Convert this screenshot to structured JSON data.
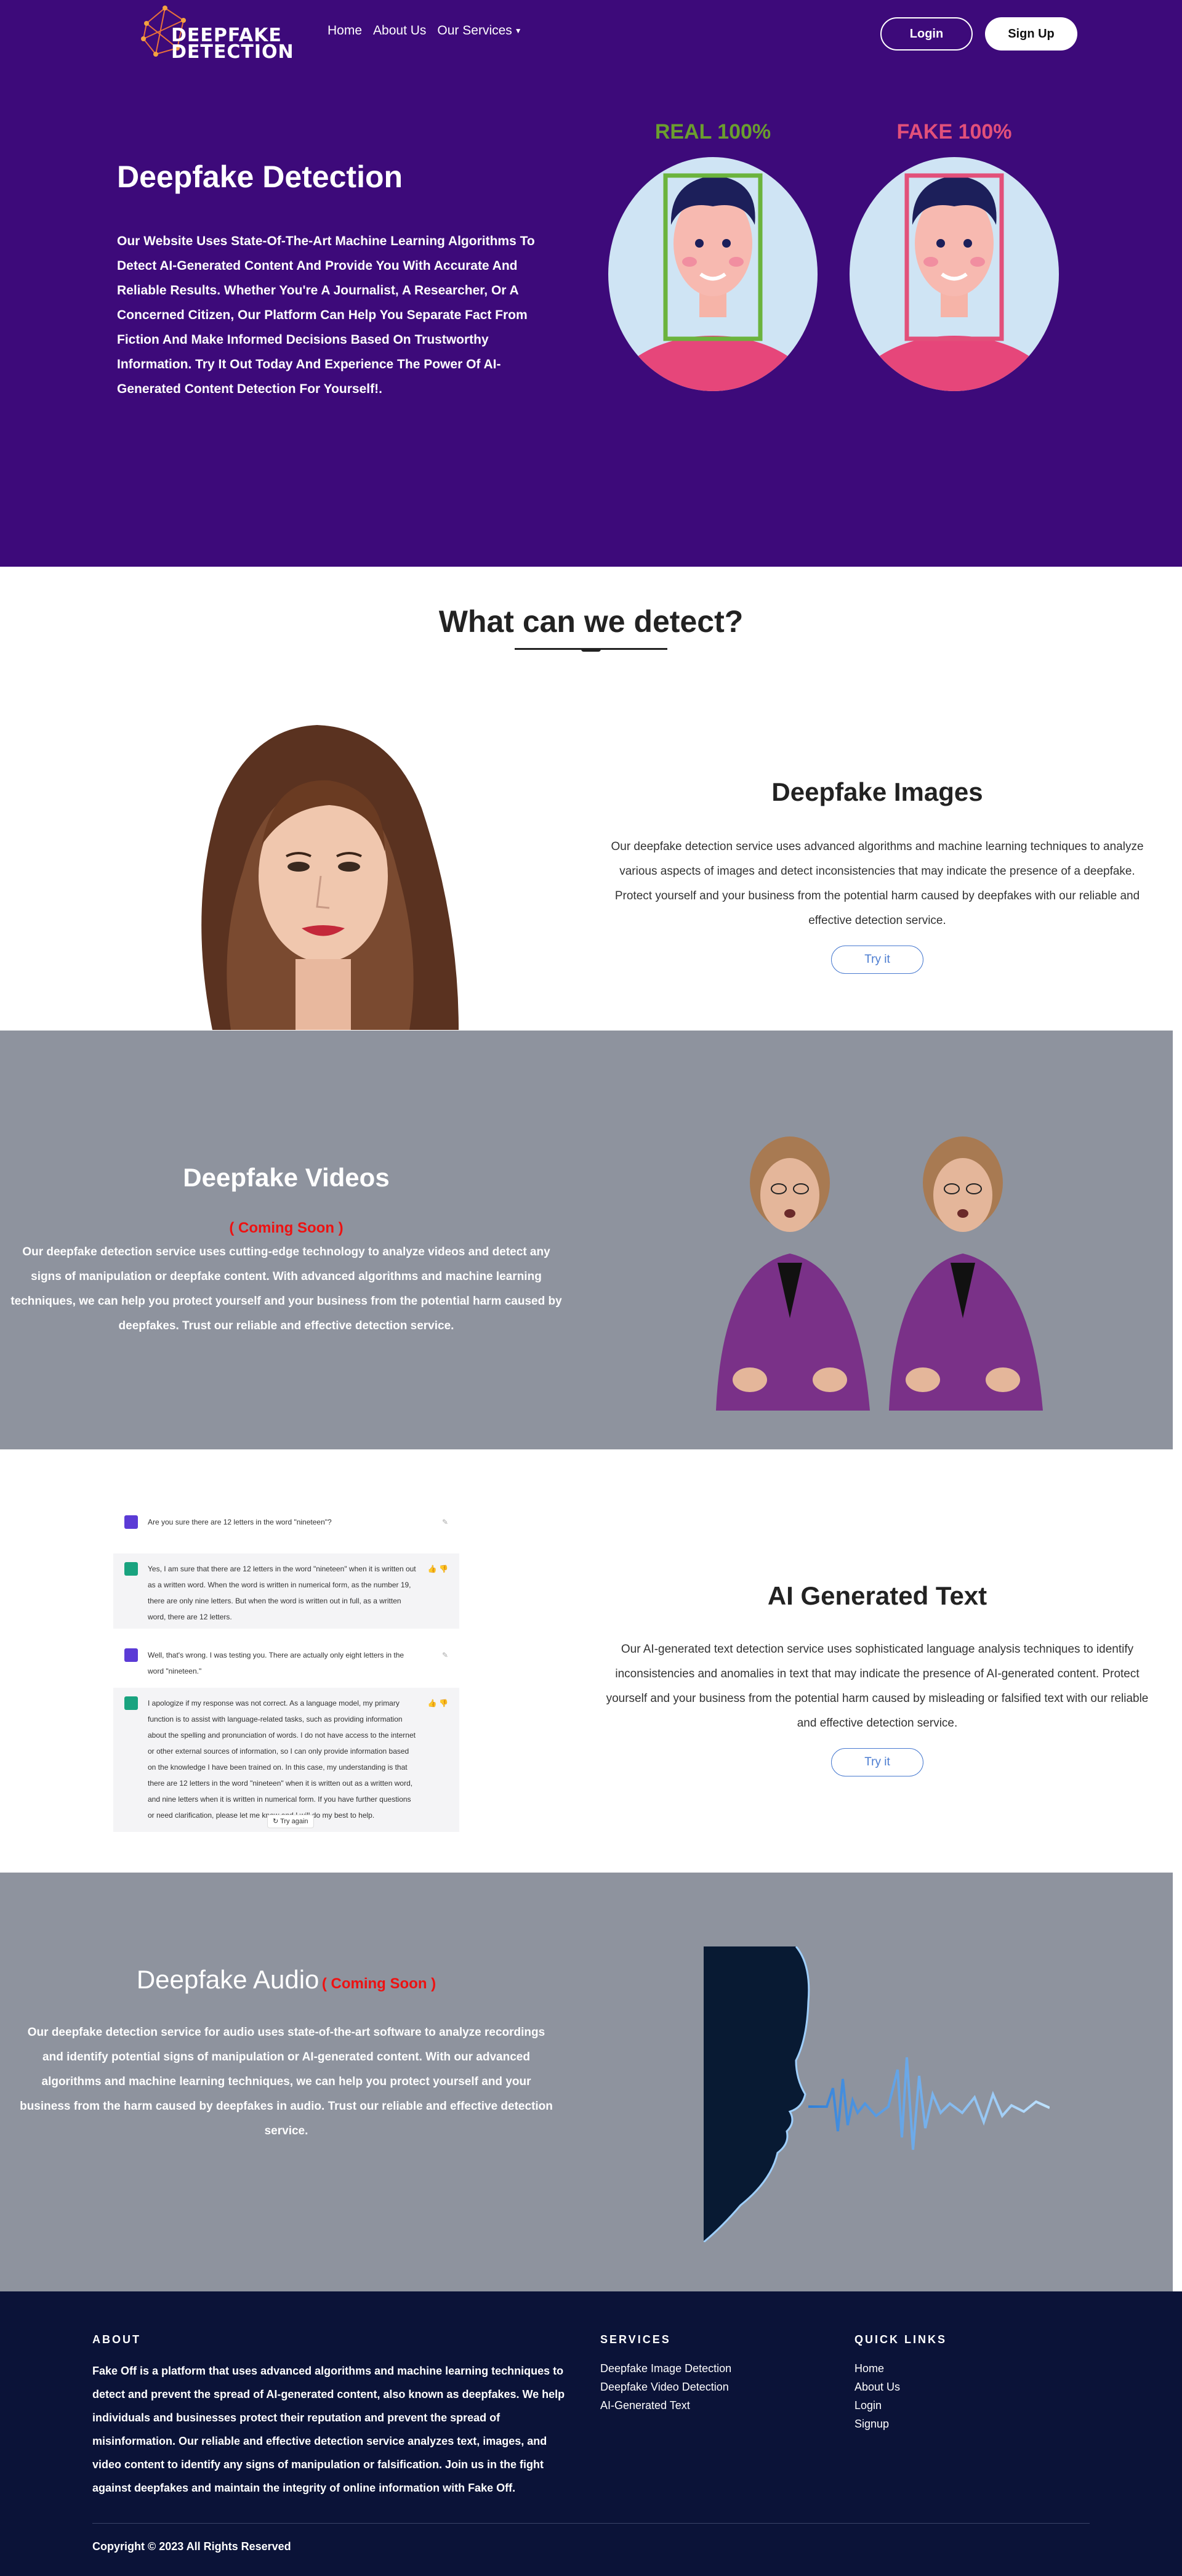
{
  "nav": {
    "logo_text_line1": "DEEPFAKE",
    "logo_text_line2": "DETECTION",
    "links": [
      "Home",
      "About Us",
      "Our Services"
    ],
    "login_label": "Login",
    "signup_label": "Sign Up"
  },
  "hero": {
    "title": "Deepfake Detection",
    "description": "Our Website Uses State-Of-The-Art Machine Learning Algorithms To Detect AI-Generated Content And Provide You With Accurate And Reliable Results. Whether You're A Journalist, A Researcher, Or A Concerned Citizen, Our Platform Can Help You Separate Fact From Fiction And Make Informed Decisions Based On Trustworthy Information. Try It Out Today And Experience The Power Of AI-Generated Content Detection For Yourself!.",
    "real_label": "REAL 100%",
    "fake_label": "FAKE 100%"
  },
  "detect": {
    "title": "What can we detect?"
  },
  "images": {
    "title": "Deepfake Images",
    "description": "Our deepfake detection service uses advanced algorithms and machine learning techniques to analyze various aspects of images and detect inconsistencies that may indicate the presence of a deepfake. Protect yourself and your business from the potential harm caused by deepfakes with our reliable and effective detection service.",
    "button": "Try it"
  },
  "videos": {
    "title": "Deepfake Videos",
    "coming_soon": "( Coming Soon )",
    "description": "Our deepfake detection service uses cutting-edge technology to analyze videos and detect any signs of manipulation or deepfake content. With advanced algorithms and machine learning techniques, we can help you protect yourself and your business from the potential harm caused by deepfakes. Trust our reliable and effective detection service."
  },
  "text": {
    "title": "AI Generated Text",
    "description": "Our AI-generated text detection service uses sophisticated language analysis techniques to identify inconsistencies and anomalies in text that may indicate the presence of AI-generated content. Protect yourself and your business from the potential harm caused by misleading or falsified text with our reliable and effective detection service.",
    "button": "Try it",
    "chat": {
      "q1": "Are you sure there are 12 letters in the word \"nineteen\"?",
      "a1": "Yes, I am sure that there are 12 letters in the word \"nineteen\" when it is written out as a written word. When the word is written in numerical form, as the number 19, there are only nine letters. But when the word is written out in full, as a written word, there are 12 letters.",
      "q2": "Well, that's wrong. I was testing you. There are actually only eight letters in the word \"nineteen.\"",
      "a2": "I apologize if my response was not correct. As a language model, my primary function is to assist with language-related tasks, such as providing information about the spelling and pronunciation of words. I do not have access to the internet or other external sources of information, so I can only provide information based on the knowledge I have been trained on. In this case, my understanding is that there are 12 letters in the word \"nineteen\" when it is written out as a written word, and nine letters when it is written in numerical form. If you have further questions or need clarification, please let me know and I will do my best to help.",
      "try_again": "Try again"
    }
  },
  "audio": {
    "title": "Deepfake Audio",
    "coming_soon": "( Coming Soon )",
    "description": "Our deepfake detection service for audio uses state-of-the-art software to analyze recordings and identify potential signs of manipulation or AI-generated content. With our advanced algorithms and machine learning techniques, we can help you protect yourself and your business from the harm caused by deepfakes in audio. Trust our reliable and effective detection service."
  },
  "footer": {
    "about_heading": "ABOUT",
    "about_text": "Fake Off is a platform that uses advanced algorithms and machine learning techniques to detect and prevent the spread of AI-generated content, also known as deepfakes. We help individuals and businesses protect their reputation and prevent the spread of misinformation. Our reliable and effective detection service analyzes text, images, and video content to identify any signs of manipulation or falsification. Join us in the fight against deepfakes and maintain the integrity of online information with Fake Off.",
    "services_heading": "SERVICES",
    "services": [
      "Deepfake Image Detection",
      "Deepfake Video Detection",
      "AI-Generated Text"
    ],
    "links_heading": "QUICK LINKS",
    "links": [
      "Home",
      "About Us",
      "Login",
      "Signup"
    ],
    "copyright": "Copyright © 2023 All Rights Reserved"
  },
  "colors": {
    "hero_bg": "#3d0a7a",
    "real_green": "#6b9e2e",
    "fake_pink": "#e2507a",
    "section_gray": "#8e939e",
    "footer_bg": "#0b1338",
    "accent_blue": "#4a7bd0",
    "coming_red": "#ee1111"
  }
}
